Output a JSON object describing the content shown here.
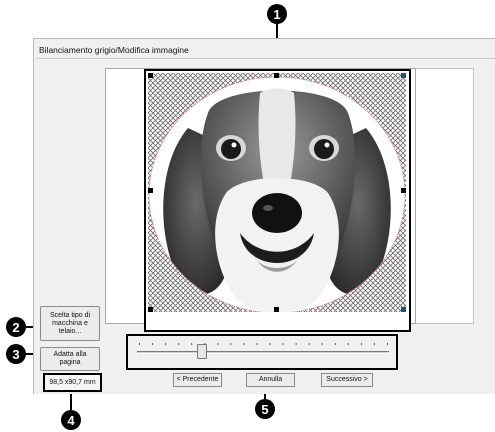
{
  "dialog": {
    "title": "Bilanciamento grigio/Modifica immagine"
  },
  "buttons": {
    "machine_frame": "Scelta tipo di macchina e telaio...",
    "fit_page": "Adatta alla pagina",
    "previous": "< Precedente",
    "cancel": "Annulla",
    "next": "Successivo >"
  },
  "image_size": "98,5 x90,7 mm",
  "slider": {
    "value_fraction": 0.27
  },
  "callouts": {
    "c1": "1",
    "c2": "2",
    "c3": "3",
    "c4": "4",
    "c5": "5"
  },
  "colors": {
    "crop_outline": "#d86a7a",
    "handle": "#000000",
    "corner_handle": "#0f5b66"
  }
}
